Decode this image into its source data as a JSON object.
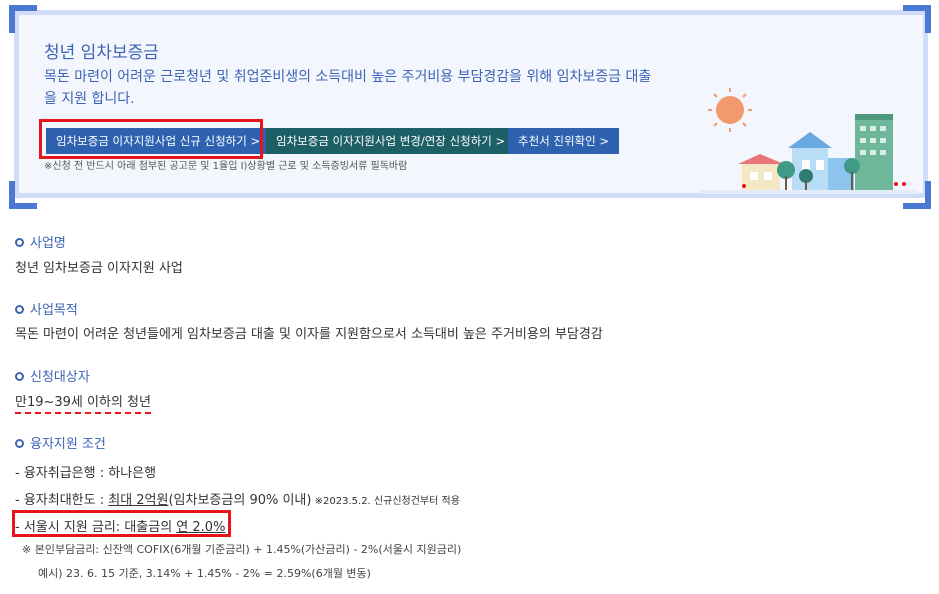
{
  "banner": {
    "title": "청년 임차보증금",
    "description": "목돈 마련이 어려운 근로청년 및 취업준비생의 소득대비 높은 주거비용 부담경감을 위해 임차보증금 대출을 지원 합니다.",
    "buttons": [
      "임차보증금 이자지원사업 신규 신청하기 >",
      "임차보증금 이자지원사업 변경/연장 신청하기 >",
      "추천서 진위확인 >"
    ],
    "note": "※신청 전 반드시 아래 첨부된 공고문 및 1율입 I)상황별 근로 및 소득증빙서류 필독바람"
  },
  "sections": {
    "business_name": {
      "heading": "사업명",
      "text": "청년 임차보증금 이자지원 사업"
    },
    "purpose": {
      "heading": "사업목적",
      "text": "목돈 마련이 어려운 청년들에게 임차보증금 대출 및 이자를 지원함으로서 소득대비 높은 주거비용의 부담경감"
    },
    "target": {
      "heading": "신청대상자",
      "text": "만19~39세 이하의 청년"
    },
    "conditions": {
      "heading": "융자지원 조건",
      "bank": "- 융자취급은행 : 하나은행",
      "limit_prefix": "- 융자최대한도 : ",
      "limit_value": "최대 2억원",
      "limit_suffix": "(임차보증금의 90% 이내)",
      "limit_note": " ※2023.5.2. 신규신청건부터 적용",
      "rate_prefix": "- 서울시 지원 금리: 대출금의 ",
      "rate_value": "연 2.0%",
      "rate_note_1": "※ 본인부담금리: 신잔액 COFIX(6개월 기준금리) + 1.45%(가산금리) - 2%(서울시 지원금리)",
      "rate_note_2": "예시) 23. 6. 15 기준, 3.14% + 1.45% - 2% = 2.59%(6개월 변동)"
    }
  },
  "colors": {
    "accent": "#3c64b4",
    "button_blue": "#2e62b0",
    "button_teal": "#1d5f66",
    "highlight": "#e8141b"
  }
}
